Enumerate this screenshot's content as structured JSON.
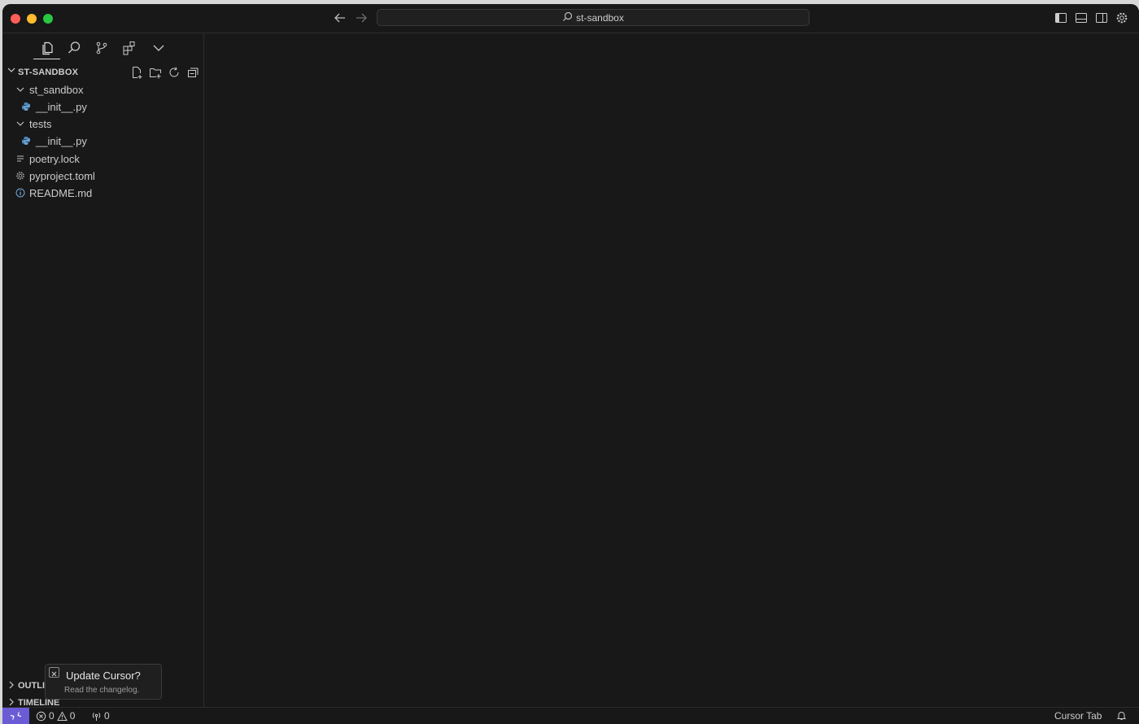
{
  "window": {
    "search_label": "st-sandbox"
  },
  "sidebar": {
    "activity_icons": [
      "files-icon",
      "search-icon",
      "source-control-icon",
      "extensions-icon",
      "chevron-down-icon"
    ],
    "explorer": {
      "title": "ST-SANDBOX",
      "actions": [
        "new-file-icon",
        "new-folder-icon",
        "refresh-icon",
        "collapse-all-icon"
      ],
      "tree": [
        {
          "label": "st_sandbox",
          "type": "folder",
          "expanded": true
        },
        {
          "label": "__init__.py",
          "type": "python-file"
        },
        {
          "label": "tests",
          "type": "folder",
          "expanded": true
        },
        {
          "label": "__init__.py",
          "type": "python-file"
        },
        {
          "label": "poetry.lock",
          "type": "lock-file"
        },
        {
          "label": "pyproject.toml",
          "type": "settings-file"
        },
        {
          "label": "README.md",
          "type": "info-file"
        }
      ]
    },
    "panels": {
      "outline": "OUTLI",
      "timeline": "TIMELINE"
    }
  },
  "notification": {
    "title": "Update Cursor?",
    "subtitle": "Read the changelog."
  },
  "statusbar": {
    "errors": "0",
    "warnings": "0",
    "ports": "0",
    "cursor_tab": "Cursor Tab"
  },
  "colors": {
    "background": "#181818",
    "accent": "#6b5cd6",
    "python_icon": "#4b8bbe"
  }
}
